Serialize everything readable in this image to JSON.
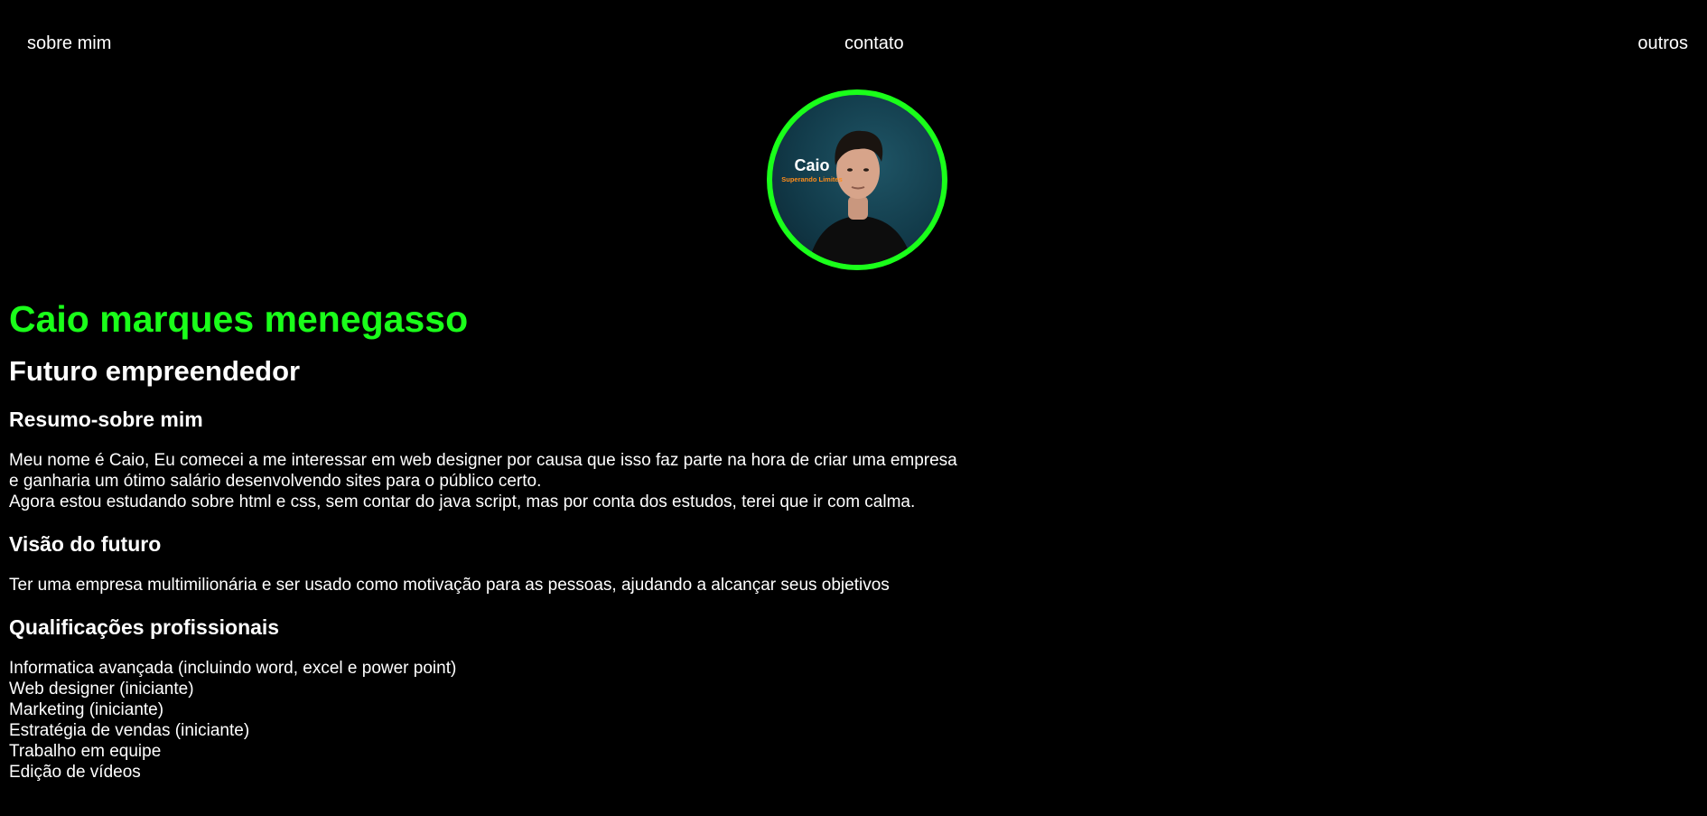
{
  "nav": {
    "items": [
      {
        "label": "sobre mim"
      },
      {
        "label": "contato"
      },
      {
        "label": "outros"
      }
    ]
  },
  "profile": {
    "photo_caption_name": "Caio",
    "photo_caption_tagline": "Superando Limites",
    "ring_color": "#1aff1a"
  },
  "name": "Caio marques menegasso",
  "subtitle": "Futuro empreendedor",
  "sections": {
    "about": {
      "heading": "Resumo-sobre mim",
      "lines": [
        "Meu nome é Caio, Eu comecei a me interessar em web designer por causa que isso faz parte na hora de criar uma empresa",
        "e ganharia um ótimo salário desenvolvendo sites para o público certo.",
        "Agora estou estudando sobre html e css, sem contar do java script, mas por conta dos estudos, terei que ir com calma."
      ]
    },
    "vision": {
      "heading": "Visão do futuro",
      "text": "Ter uma empresa multimilionária e ser usado como motivação para as pessoas, ajudando a alcançar seus objetivos"
    },
    "qualifications": {
      "heading": "Qualificações profissionais",
      "items": [
        "Informatica avançada (incluindo word, excel e power point)",
        "Web designer (iniciante)",
        "Marketing (iniciante)",
        "Estratégia de vendas (iniciante)",
        "Trabalho em equipe",
        "Edição de vídeos"
      ]
    }
  },
  "colors": {
    "background": "#000000",
    "accent": "#1aff1a",
    "text": "#ffffff",
    "tagline": "#ff8c1a"
  }
}
